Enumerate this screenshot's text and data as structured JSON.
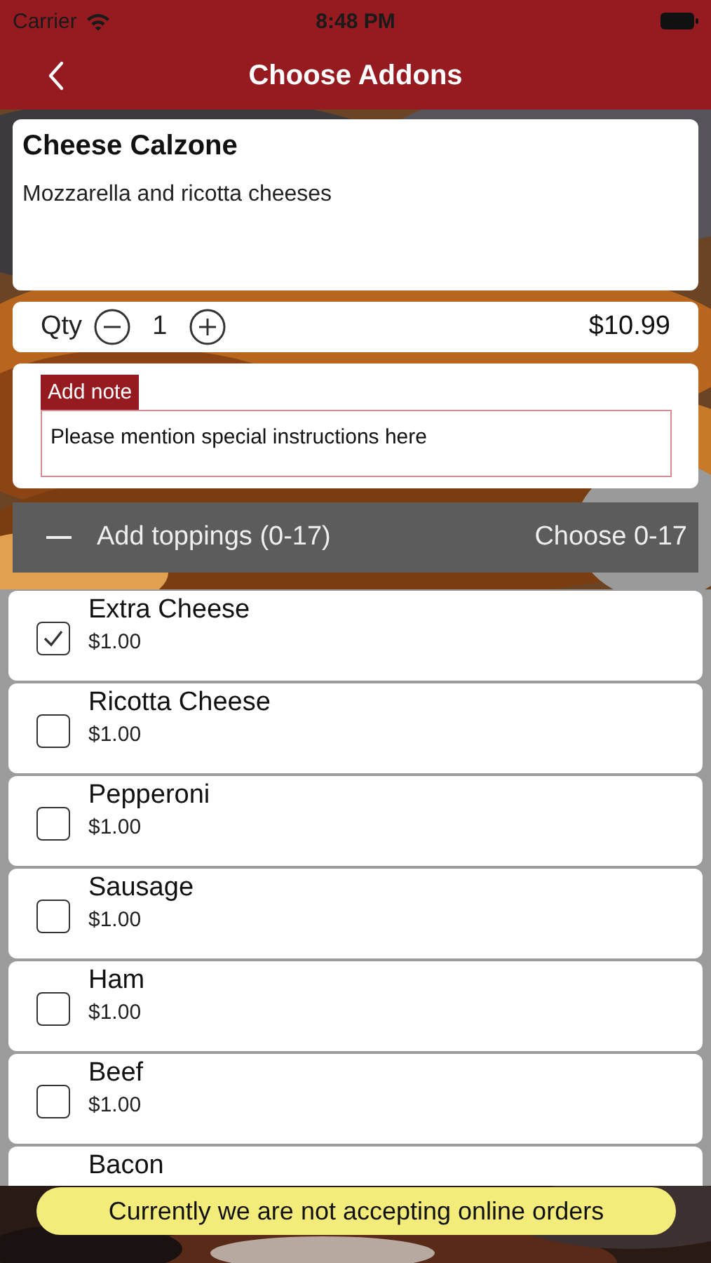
{
  "status_bar": {
    "carrier": "Carrier",
    "time": "8:48 PM"
  },
  "nav": {
    "title": "Choose Addons"
  },
  "item": {
    "name": "Cheese Calzone",
    "description": "Mozzarella and ricotta cheeses"
  },
  "quantity": {
    "label": "Qty",
    "value": "1",
    "price": "$10.99"
  },
  "note": {
    "label": "Add note",
    "placeholder": "Please mention special instructions here"
  },
  "group": {
    "title": "Add toppings (0-17)",
    "rule": "Choose 0-17",
    "expanded": true
  },
  "toppings": [
    {
      "name": "Extra Cheese",
      "price": "$1.00",
      "checked": true
    },
    {
      "name": "Ricotta Cheese",
      "price": "$1.00",
      "checked": false
    },
    {
      "name": "Pepperoni",
      "price": "$1.00",
      "checked": false
    },
    {
      "name": "Sausage",
      "price": "$1.00",
      "checked": false
    },
    {
      "name": "Ham",
      "price": "$1.00",
      "checked": false
    },
    {
      "name": "Beef",
      "price": "$1.00",
      "checked": false
    },
    {
      "name": "Bacon"
    }
  ],
  "banner": {
    "message": "Currently we are not accepting online orders"
  }
}
